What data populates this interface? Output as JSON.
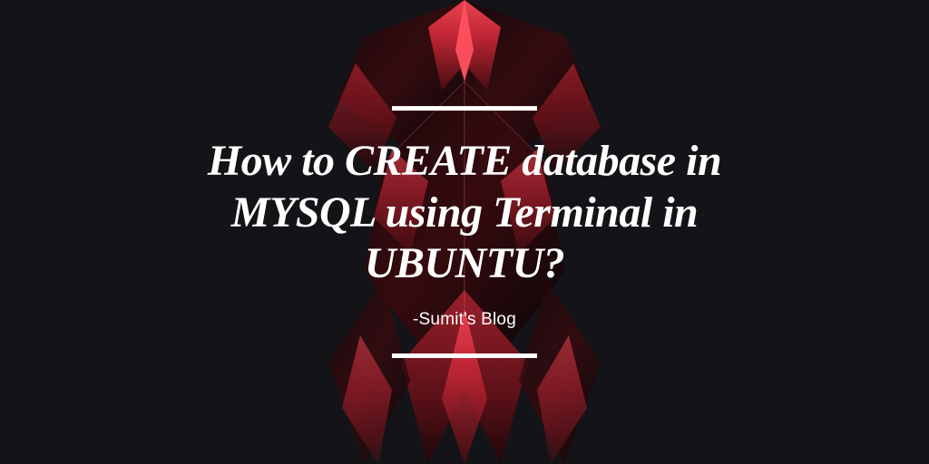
{
  "title": "How to CREATE database in MYSQL using Terminal in UBUNTU?",
  "author": "-Sumit's Blog",
  "colors": {
    "background": "#141418",
    "text": "#ffffff",
    "accent_red_dark": "#3a0a0e",
    "accent_red_mid": "#8a1420",
    "accent_red_bright": "#d93040"
  }
}
